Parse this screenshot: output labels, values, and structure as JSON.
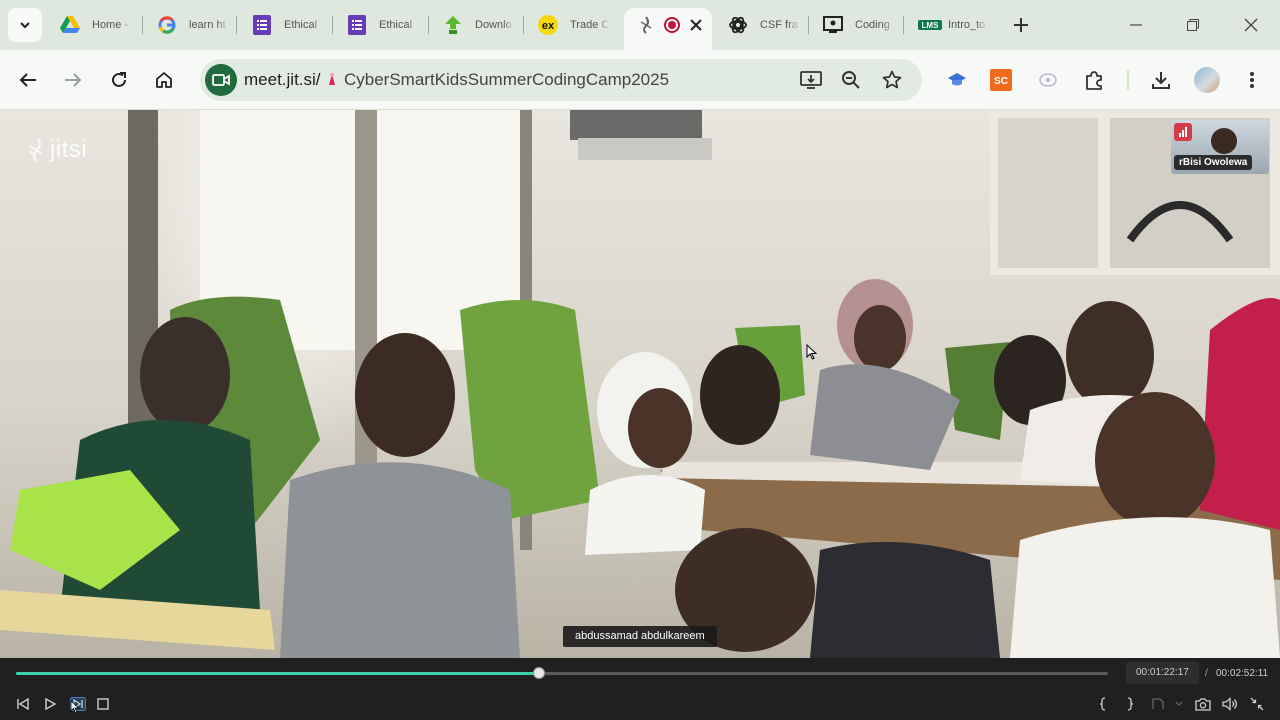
{
  "tabs": [
    {
      "title": "Home - ",
      "icon": "google-drive-icon"
    },
    {
      "title": "learn ht",
      "icon": "google-icon"
    },
    {
      "title": "Ethical ",
      "icon": "google-forms-icon"
    },
    {
      "title": "Ethical ",
      "icon": "google-forms-icon"
    },
    {
      "title": "Downlo",
      "icon": "download-site-icon"
    },
    {
      "title": "Trade C",
      "icon": "ex-icon"
    },
    {
      "title": "",
      "icon": "jitsi-recording-icon",
      "active": true
    },
    {
      "title": "CSF fra",
      "icon": "openai-icon"
    },
    {
      "title": "Coding",
      "icon": "classroom-icon"
    },
    {
      "title": "Intro_to",
      "icon": "lms-icon"
    }
  ],
  "address_bar": {
    "host": "meet.jit.si/",
    "path": "CyberSmartKidsSummerCodingCamp2025"
  },
  "colors": {
    "progress": "#3fcfb0",
    "chip": "#1f6b3d",
    "tabstrip": "#dfe8df"
  },
  "meeting": {
    "logo_text": "jitsi",
    "thumbnail_name": "rBisi Owolewa",
    "speaker_caption": "abdussamad abdulkareem"
  },
  "player": {
    "current_time": "00:01:22:17",
    "separator": "/",
    "total_time": "00:02:52:11",
    "progress": 0.479
  }
}
